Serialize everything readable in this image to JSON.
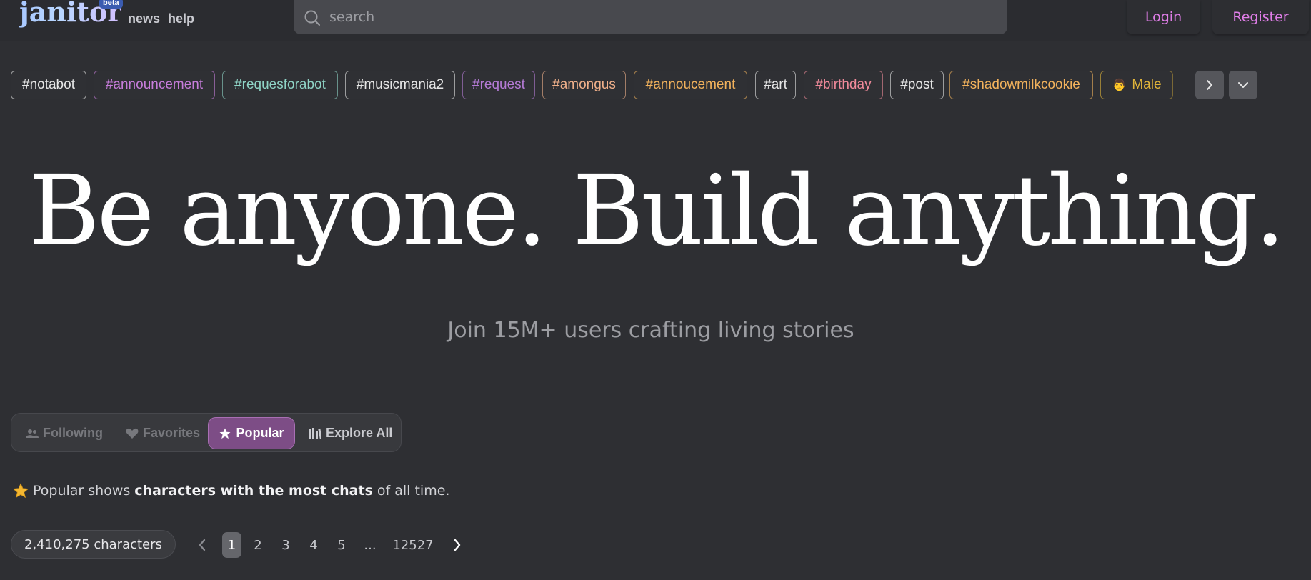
{
  "header": {
    "logo_text": "janitor",
    "beta_label": "beta",
    "nav": {
      "news": "news",
      "help": "help"
    },
    "search_placeholder": "search",
    "login_label": "Login",
    "register_label": "Register"
  },
  "tags": [
    {
      "label": "#notabot",
      "color": "#e6e6e6"
    },
    {
      "label": "#announcement",
      "color": "#c77ddb"
    },
    {
      "label": "#requesforabot",
      "color": "#8fd4c6"
    },
    {
      "label": "#musicmania2",
      "color": "#e6e6e6"
    },
    {
      "label": "#request",
      "color": "#b57bd6"
    },
    {
      "label": "#amongus",
      "color": "#f0b08a"
    },
    {
      "label": "#annoucement",
      "color": "#f2b25c"
    },
    {
      "label": "#art",
      "color": "#e6e6e6"
    },
    {
      "label": "#birthday",
      "color": "#f08a9a"
    },
    {
      "label": "#post",
      "color": "#e6e6e6"
    },
    {
      "label": "#shadowmilkcookie",
      "color": "#f2b25c"
    },
    {
      "label": "Male",
      "color": "#e0b43a",
      "emoji": "👨"
    }
  ],
  "hero": {
    "title": "Be anyone. Build anything.",
    "subtitle": "Join 15M+ users crafting living stories"
  },
  "modes": {
    "following": "Following",
    "favorites": "Favorites",
    "popular": "Popular",
    "explore_all": "Explore All",
    "active": "Popular"
  },
  "description": {
    "prefix": "Popular shows",
    "bold": "characters with the most chats",
    "suffix": "of all time."
  },
  "pagination": {
    "count_label": "2,410,275 characters",
    "pages": [
      "1",
      "2",
      "3",
      "4",
      "5"
    ],
    "ellipsis": "...",
    "last_page": "12527",
    "current": "1"
  },
  "colors": {
    "accent": "#e07ee8",
    "popular_bg": "#7d4d86",
    "background": "#2e2f33"
  }
}
